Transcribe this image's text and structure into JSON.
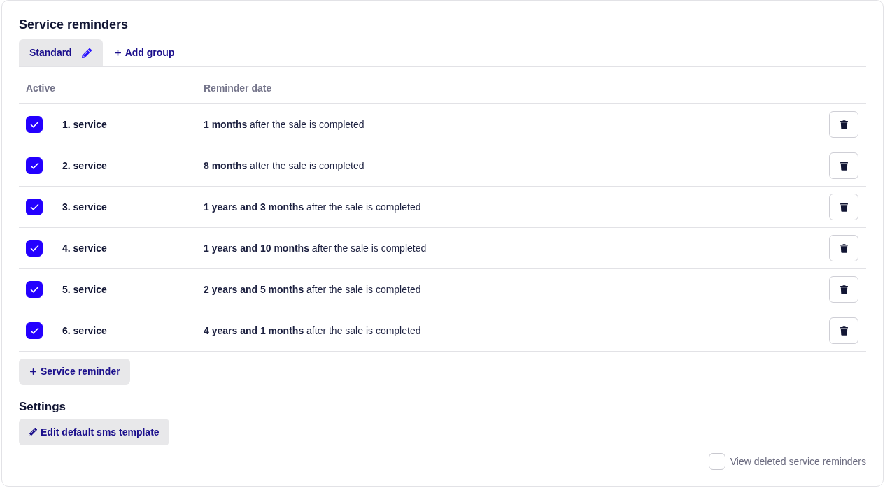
{
  "title": "Service reminders",
  "group_tabs": [
    {
      "label": "Standard",
      "selected": true
    }
  ],
  "add_group_link": "Add group",
  "table": {
    "columns": [
      "Active",
      "Reminder date"
    ],
    "rows": [
      {
        "active": true,
        "name": "1. service",
        "reminder_date": "**1 months** after the sale is completed"
      },
      {
        "active": true,
        "name": "2. service",
        "reminder_date": "**8 months** after the sale is completed"
      },
      {
        "active": true,
        "name": "3. service",
        "reminder_date": "**1 years and 3 months** after the sale is completed"
      },
      {
        "active": true,
        "name": "4. service",
        "reminder_date": "**1 years and 10 months** after the sale is completed"
      },
      {
        "active": true,
        "name": "5. service",
        "reminder_date": "**2 years and 5 months** after the sale is completed"
      },
      {
        "active": true,
        "name": "6. service",
        "reminder_date": "**4 years and 1 months** after the sale is completed"
      }
    ]
  },
  "add_reminder_button": "Service reminder",
  "settings": {
    "title": "Settings",
    "edit_template_button": "Edit default sms template"
  },
  "view_deleted": {
    "label": "View deleted service reminders",
    "checked": false
  }
}
